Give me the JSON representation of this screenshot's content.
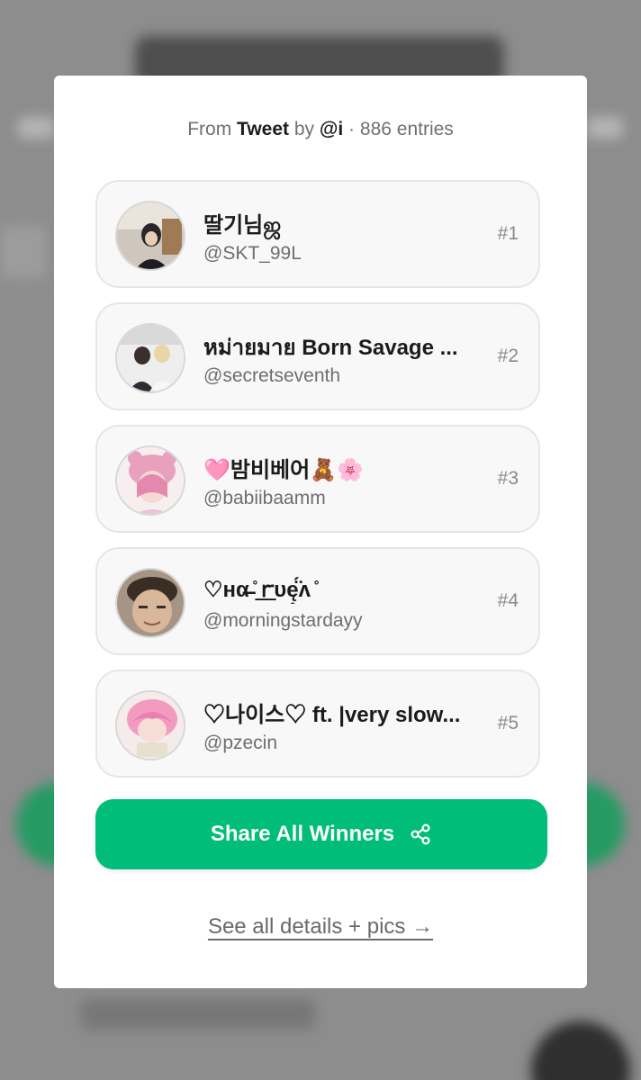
{
  "header": {
    "prefix": "From",
    "source": "Tweet",
    "by": "by",
    "author": "@i",
    "separator": "·",
    "entries": "886 entries"
  },
  "winners": [
    {
      "name": "딸기님ஜ",
      "handle": "@SKT_99L",
      "rank": "#1",
      "avatar_colors": [
        "#3b3a3f",
        "#9a8a7a"
      ]
    },
    {
      "name": "หม่ายมาย Born Savage ...",
      "handle": "@secretseventh",
      "rank": "#2",
      "avatar_colors": [
        "#dcdcdc",
        "#f3f3f3"
      ]
    },
    {
      "name": "🩷밤비베어🧸🌸",
      "handle": "@babiibaamm",
      "rank": "#3",
      "avatar_colors": [
        "#e9aec4",
        "#f5d2da"
      ]
    },
    {
      "name": "♡нα̶̶̶̶̶̶ ̊ ͟ꭈᴜę͙̈̈́ʌ ̊",
      "handle": "@morningstardayy",
      "rank": "#4",
      "avatar_colors": [
        "#6d5a48",
        "#c8b49c"
      ]
    },
    {
      "name": "♡나이스♡ ft. |very slow...",
      "handle": "@pzecin",
      "rank": "#5",
      "avatar_colors": [
        "#f2a1c2",
        "#f7dce5"
      ]
    }
  ],
  "share_button": {
    "label": "Share All Winners",
    "icon": "share-icon",
    "color": "#00bd7a"
  },
  "details_link": {
    "label": "See all details + pics →"
  }
}
